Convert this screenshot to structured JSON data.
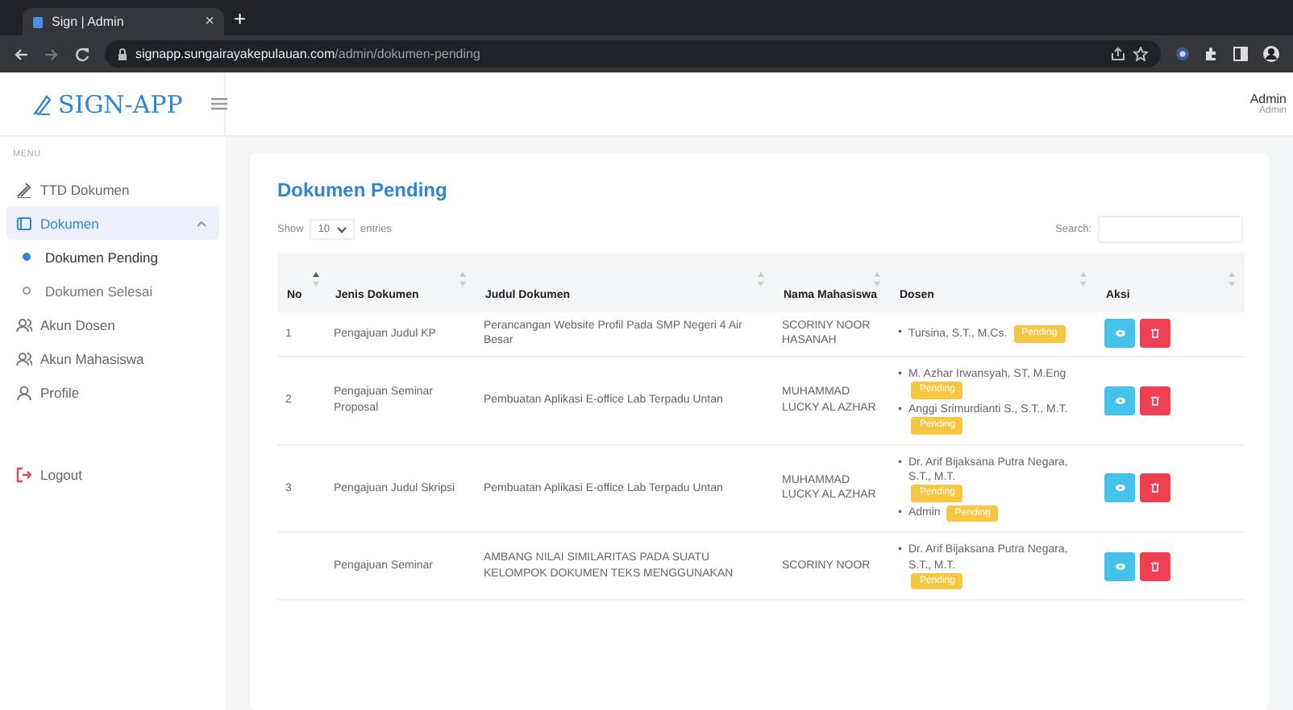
{
  "browser": {
    "tab_title": "Sign | Admin",
    "tab_close": "×",
    "new_tab": "+",
    "url_host": "signapp.sungairayakepulauan.com",
    "url_path": "/admin/dokumen-pending"
  },
  "header": {
    "logo": "SIGN-APP",
    "user_name": "Admin",
    "user_role": "Admin"
  },
  "sidebar": {
    "heading": "MENU",
    "items": [
      {
        "label": "TTD Dokumen",
        "kind": "link",
        "selected": false
      },
      {
        "label": "Dokumen",
        "kind": "group",
        "selected": true,
        "expanded": true,
        "children": [
          {
            "label": "Dokumen Pending",
            "selected": true
          },
          {
            "label": "Dokumen Selesai",
            "selected": false
          }
        ]
      },
      {
        "label": "Akun Dosen",
        "kind": "link",
        "selected": false
      },
      {
        "label": "Akun Mahasiswa",
        "kind": "link",
        "selected": false
      },
      {
        "label": "Profile",
        "kind": "link",
        "selected": false
      },
      {
        "label": "Logout",
        "kind": "logout",
        "selected": false
      }
    ]
  },
  "card": {
    "title": "Dokumen Pending",
    "show_label": "Show",
    "page_length": "10",
    "entries_label": "entries",
    "search_label": "Search:",
    "columns": [
      {
        "label": "No",
        "sorted": true
      },
      {
        "label": "Jenis Dokumen",
        "sorted": false
      },
      {
        "label": "Judul Dokumen",
        "sorted": false
      },
      {
        "label": "Nama Mahasiswa",
        "sorted": false
      },
      {
        "label": "Dosen",
        "sorted": false
      },
      {
        "label": "Aksi",
        "sorted": false
      }
    ],
    "rows": [
      {
        "no": "1",
        "jenis": "Pengajuan Judul KP",
        "judul": "Perancangan Website Profil Pada SMP Negeri 4 Air Besar",
        "nama": "SCORINY NOOR HASANAH",
        "dosen": [
          {
            "bullet": "•",
            "name": "Tursina, S.T., M.Cs.",
            "status": "Pending"
          }
        ]
      },
      {
        "no": "2",
        "jenis": "Pengajuan Seminar Proposal",
        "judul": "Pembuatan Aplikasi E-office Lab Terpadu Untan",
        "nama": "MUHAMMAD LUCKY AL AZHAR",
        "dosen": [
          {
            "bullet": "•",
            "name": "M. Azhar Irwansyah, ST, M.Eng",
            "status": "Pending"
          },
          {
            "bullet": "•",
            "name": "Anggi Srimurdianti S., S.T., M.T.",
            "status": "Pending"
          }
        ]
      },
      {
        "no": "3",
        "jenis": "Pengajuan Judul Skripsi",
        "judul": "Pembuatan Aplikasi E-office Lab Terpadu Untan",
        "nama": "MUHAMMAD LUCKY AL AZHAR",
        "dosen": [
          {
            "bullet": "•",
            "name": "Dr. Arif Bijaksana Putra Negara, S.T., M.T.",
            "status": "Pending"
          },
          {
            "bullet": "•",
            "name": "Admin",
            "status": "Pending"
          }
        ]
      },
      {
        "jenis": "Pengajuan Seminar",
        "judul": "AMBANG NILAI SIMILARITAS PADA SUATU KELOMPOK DOKUMEN TEKS MENGGUNAKAN",
        "nama": "SCORINY NOOR",
        "dosen": [
          {
            "bullet": "•",
            "name": "Dr. Arif Bijaksana Putra Negara, S.T., M.T.",
            "status": "Pending"
          }
        ]
      }
    ]
  }
}
